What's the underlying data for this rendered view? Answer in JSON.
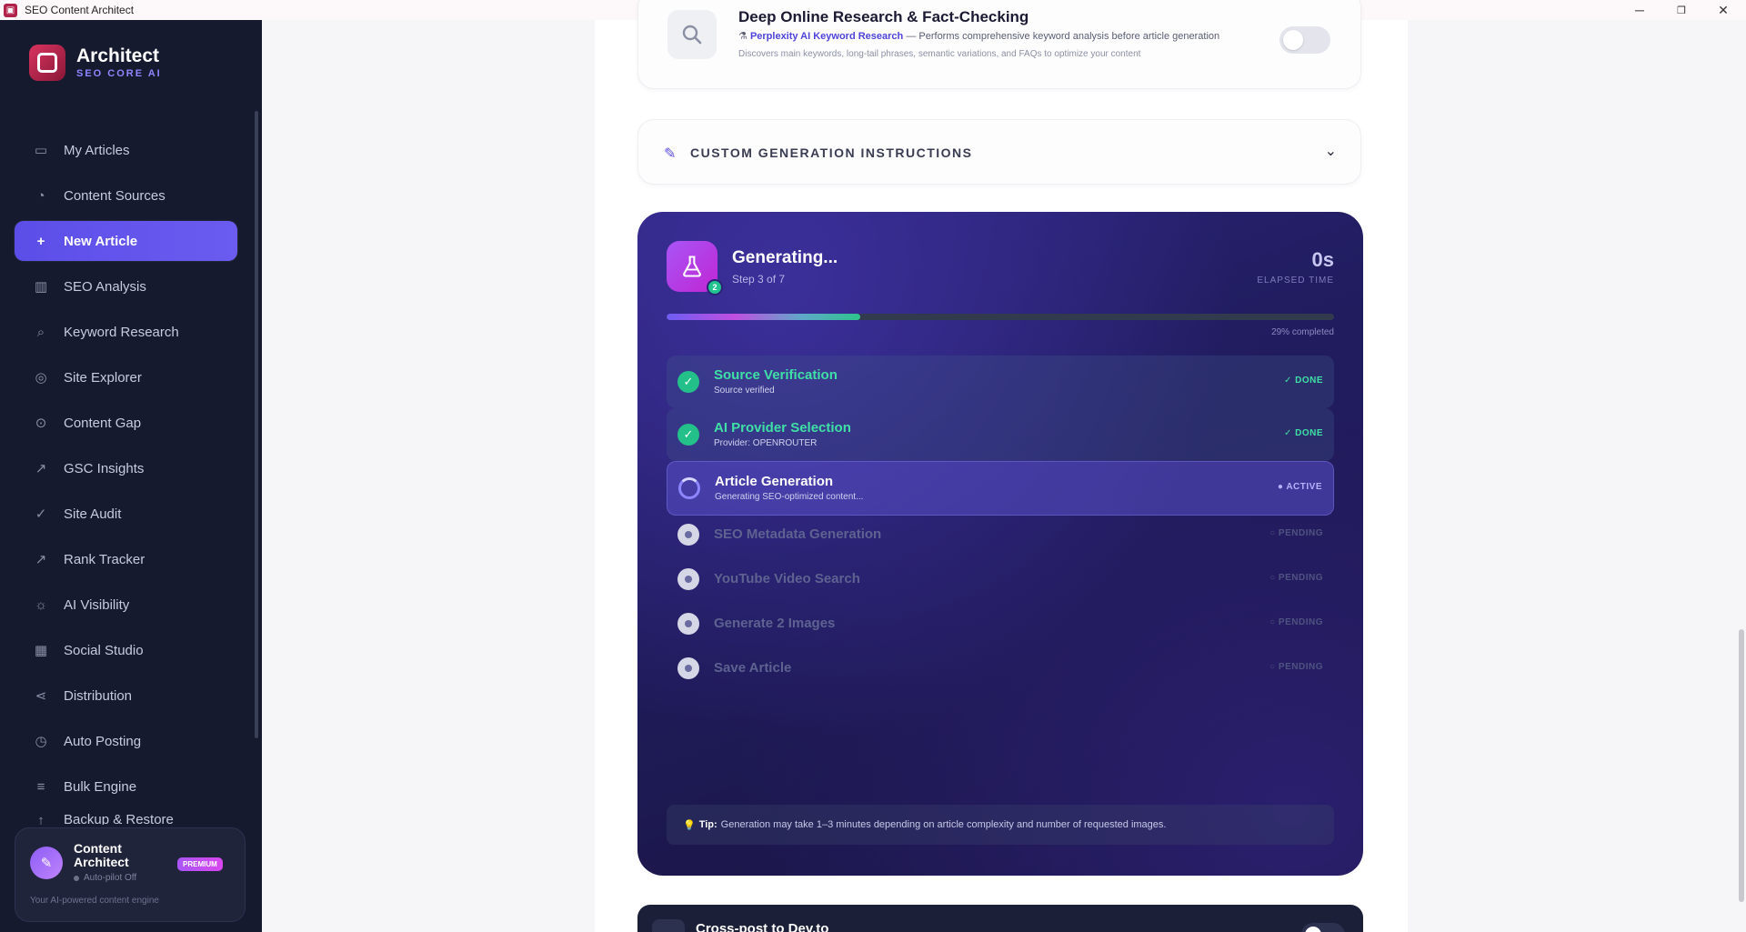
{
  "window": {
    "title": "SEO Content Architect",
    "controls": {
      "minimize": "─",
      "maximize": "❐",
      "close": "✕"
    }
  },
  "brand": {
    "name": "Architect",
    "subtitle": "SEO CORE AI"
  },
  "sidebar": {
    "items": [
      {
        "label": "My Articles",
        "icon": "folder-icon",
        "glyph": "▭"
      },
      {
        "label": "Content Sources",
        "icon": "rss-icon",
        "glyph": "◔"
      },
      {
        "label": "New Article",
        "icon": "plus-icon",
        "glyph": "+",
        "active": true
      },
      {
        "label": "SEO Analysis",
        "icon": "bar-chart-icon",
        "glyph": "▥"
      },
      {
        "label": "Keyword Research",
        "icon": "search-icon",
        "glyph": "⌕"
      },
      {
        "label": "Site Explorer",
        "icon": "globe-icon",
        "glyph": "◎"
      },
      {
        "label": "Content Gap",
        "icon": "target-icon",
        "glyph": "⊙"
      },
      {
        "label": "GSC Insights",
        "icon": "trend-icon",
        "glyph": "↗"
      },
      {
        "label": "Site Audit",
        "icon": "check-circle-icon",
        "glyph": "✓"
      },
      {
        "label": "Rank Tracker",
        "icon": "trend-up-icon",
        "glyph": "↗"
      },
      {
        "label": "AI Visibility",
        "icon": "lightbulb-icon",
        "glyph": "☼"
      },
      {
        "label": "Social Studio",
        "icon": "film-icon",
        "glyph": "▦"
      },
      {
        "label": "Distribution",
        "icon": "share-icon",
        "glyph": "⋖"
      },
      {
        "label": "Auto Posting",
        "icon": "clock-icon",
        "glyph": "◷"
      },
      {
        "label": "Bulk Engine",
        "icon": "list-icon",
        "glyph": "≡"
      },
      {
        "label": "Backup & Restore",
        "icon": "upload-icon",
        "glyph": "↑"
      }
    ]
  },
  "premium_card": {
    "title": "Content Architect",
    "badge": "PREMIUM",
    "status": "Auto-pilot Off",
    "description": "Your AI-powered content engine"
  },
  "research": {
    "title": "Deep Online Research & Fact-Checking",
    "link_text": "Perplexity AI Keyword Research",
    "line2_rest": " — Performs comprehensive keyword analysis before article generation",
    "line3": "Discovers main keywords, long-tail phrases, semantic variations, and FAQs to optimize your content",
    "enabled": false
  },
  "instructions": {
    "label": "CUSTOM GENERATION INSTRUCTIONS"
  },
  "generation": {
    "title": "Generating...",
    "step_text": "Step 3 of 7",
    "step_badge": "2",
    "elapsed": "0s",
    "elapsed_label": "ELAPSED TIME",
    "progress_percent": 29,
    "progress_label": "29% completed",
    "steps": [
      {
        "title": "Source Verification",
        "sub": "Source verified",
        "status": "✓ DONE",
        "state": "done"
      },
      {
        "title": "AI Provider Selection",
        "sub": "Provider: OPENROUTER",
        "status": "✓ DONE",
        "state": "done"
      },
      {
        "title": "Article Generation",
        "sub": "Generating SEO-optimized content...",
        "status": "● ACTIVE",
        "state": "active"
      },
      {
        "title": "SEO Metadata Generation",
        "sub": "",
        "status": "○ PENDING",
        "state": "pending"
      },
      {
        "title": "YouTube Video Search",
        "sub": "",
        "status": "○ PENDING",
        "state": "pending"
      },
      {
        "title": "Generate 2 Images",
        "sub": "",
        "status": "○ PENDING",
        "state": "pending"
      },
      {
        "title": "Save Article",
        "sub": "",
        "status": "○ PENDING",
        "state": "pending"
      }
    ],
    "tip_label": "Tip:",
    "tip_text": "Generation may take 1–3 minutes depending on article complexity and number of requested images."
  },
  "crosspost": {
    "title": "Cross-post to Dev.to",
    "enabled": false
  },
  "colors": {
    "accent": "#5b4ee8",
    "success": "#23c08a",
    "sidebar_bg": "#161a2e"
  }
}
